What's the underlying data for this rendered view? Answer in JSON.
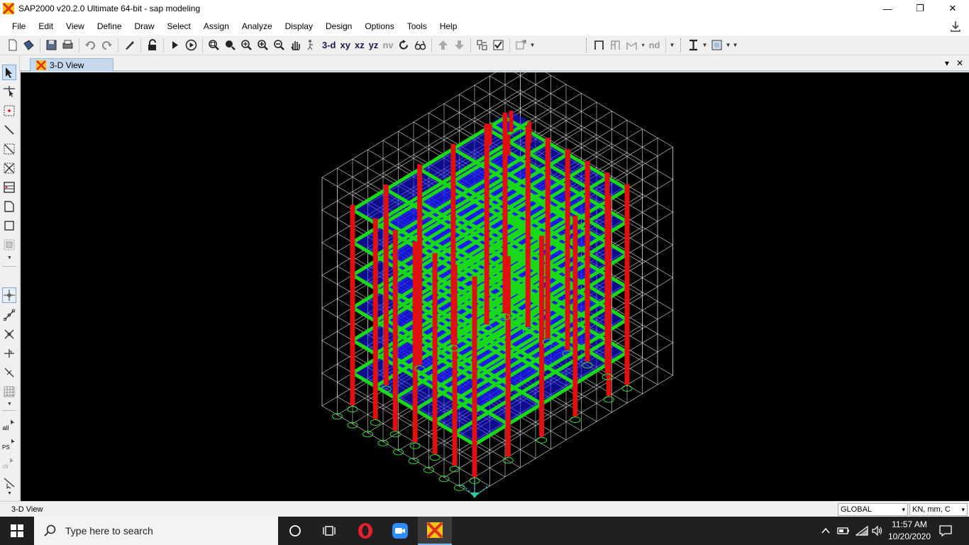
{
  "window": {
    "title": "SAP2000 v20.2.0 Ultimate 64-bit - sap modeling",
    "minimize": "—",
    "restore": "❐",
    "close": "✕"
  },
  "menu": [
    "File",
    "Edit",
    "View",
    "Define",
    "Draw",
    "Select",
    "Assign",
    "Analyze",
    "Display",
    "Design",
    "Options",
    "Tools",
    "Help"
  ],
  "toolbar": {
    "view_3d": "3-d",
    "view_xy": "xy",
    "view_xz": "xz",
    "view_yz": "yz",
    "view_nv": "nv",
    "nd": "nd"
  },
  "left_toolbar": {
    "all": "all",
    "ps": "PS",
    "clr": "clr"
  },
  "tabs": [
    {
      "label": "3-D View"
    }
  ],
  "tab_controls": {
    "dropdown": "▾",
    "close": "✕"
  },
  "status": {
    "text": "3-D View",
    "coord_system": "GLOBAL",
    "units": "KN, mm, C"
  },
  "taskbar": {
    "search_placeholder": "Type here to search",
    "time": "11:57 AM",
    "date": "10/20/2020"
  },
  "colors": {
    "columns": "#e01010",
    "beams": "#18d818",
    "slabs": "#1a1aff",
    "grid": "#d8d8d8",
    "supports": "#33dd33",
    "viewport_bg": "#000000"
  }
}
